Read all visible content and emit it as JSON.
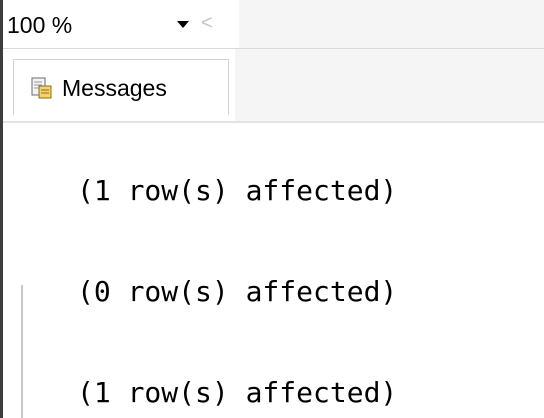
{
  "toolbar": {
    "zoom_value": "100 %",
    "dropdown_icon": "chevron-down-icon",
    "scroll_left_glyph": "<"
  },
  "tabs": [
    {
      "label": "Messages",
      "icon": "messages-icon",
      "selected": true
    }
  ],
  "messages": [
    "(1 row(s) affected)",
    "(0 row(s) affected)",
    "(1 row(s) affected)"
  ]
}
